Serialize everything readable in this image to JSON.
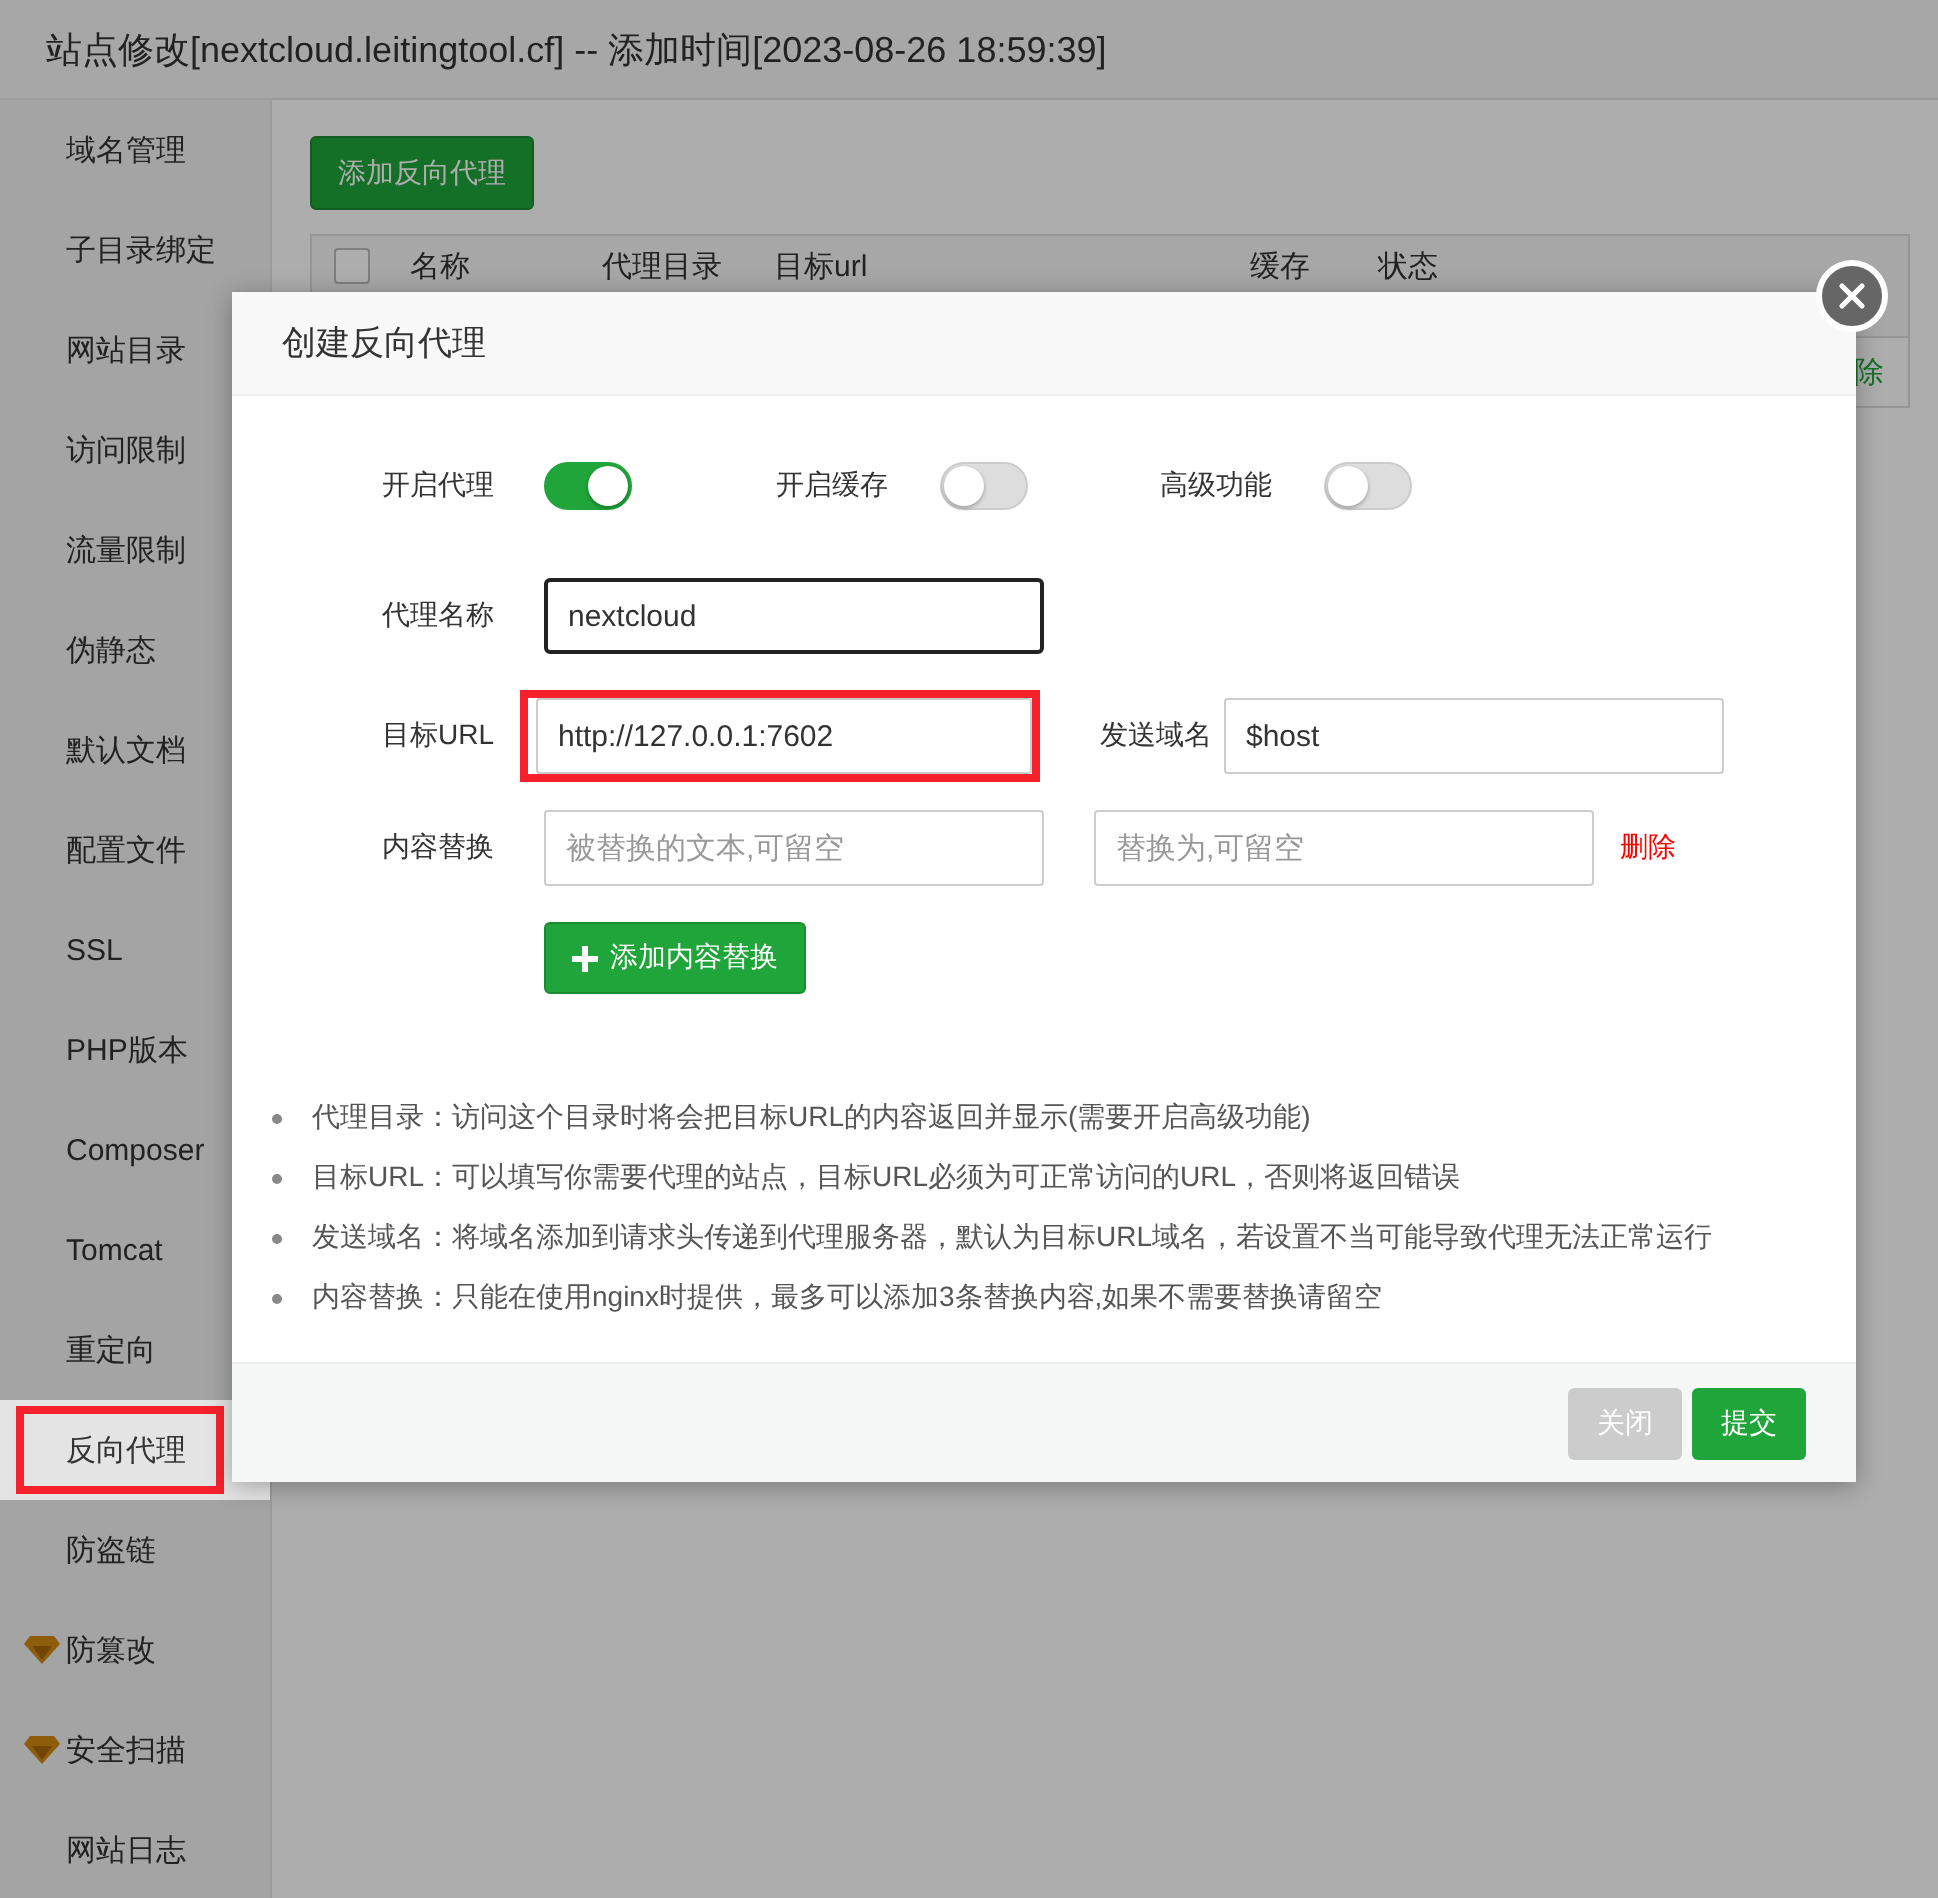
{
  "window": {
    "title": "站点修改[nextcloud.leitingtool.cf] -- 添加时间[2023-08-26 18:59:39]"
  },
  "sidebar": {
    "items": [
      {
        "label": "域名管理",
        "selected": false,
        "premium": false,
        "annotated": false
      },
      {
        "label": "子目录绑定",
        "selected": false,
        "premium": false,
        "annotated": false
      },
      {
        "label": "网站目录",
        "selected": false,
        "premium": false,
        "annotated": false
      },
      {
        "label": "访问限制",
        "selected": false,
        "premium": false,
        "annotated": false
      },
      {
        "label": "流量限制",
        "selected": false,
        "premium": false,
        "annotated": false
      },
      {
        "label": "伪静态",
        "selected": false,
        "premium": false,
        "annotated": false
      },
      {
        "label": "默认文档",
        "selected": false,
        "premium": false,
        "annotated": false
      },
      {
        "label": "配置文件",
        "selected": false,
        "premium": false,
        "annotated": false
      },
      {
        "label": "SSL",
        "selected": false,
        "premium": false,
        "annotated": false
      },
      {
        "label": "PHP版本",
        "selected": false,
        "premium": false,
        "annotated": false
      },
      {
        "label": "Composer",
        "selected": false,
        "premium": false,
        "annotated": false
      },
      {
        "label": "Tomcat",
        "selected": false,
        "premium": false,
        "annotated": false
      },
      {
        "label": "重定向",
        "selected": false,
        "premium": false,
        "annotated": false
      },
      {
        "label": "反向代理",
        "selected": true,
        "premium": false,
        "annotated": true
      },
      {
        "label": "防盗链",
        "selected": false,
        "premium": false,
        "annotated": false
      },
      {
        "label": "防篡改",
        "selected": false,
        "premium": true,
        "annotated": false
      },
      {
        "label": "安全扫描",
        "selected": false,
        "premium": true,
        "annotated": false
      },
      {
        "label": "网站日志",
        "selected": false,
        "premium": false,
        "annotated": false
      }
    ]
  },
  "toolbar": {
    "add_button": "添加反向代理"
  },
  "table": {
    "select_all": {
      "checked": false
    },
    "columns": [
      "名称",
      "代理目录",
      "目标url",
      "缓存",
      "状态"
    ],
    "row_action": "除"
  },
  "dialog": {
    "title": "创建反向代理",
    "toggles": [
      {
        "label": "开启代理",
        "on": true
      },
      {
        "label": "开启缓存",
        "on": false
      },
      {
        "label": "高级功能",
        "on": false
      }
    ],
    "proxy_name": {
      "label": "代理名称",
      "value": "nextcloud",
      "focused": true
    },
    "target_url": {
      "label": "目标URL",
      "value": "http://127.0.0.1:7602",
      "annotated": true
    },
    "send_domain": {
      "label": "发送域名",
      "value": "$host"
    },
    "replace": {
      "label": "内容替换",
      "from_placeholder": "被替换的文本,可留空",
      "to_placeholder": "替换为,可留空",
      "delete": "删除"
    },
    "add_replace_button": "添加内容替换",
    "notes": [
      "代理目录：访问这个目录时将会把目标URL的内容返回并显示(需要开启高级功能)",
      "目标URL：可以填写你需要代理的站点，目标URL必须为可正常访问的URL，否则将返回错误",
      "发送域名：将域名添加到请求头传递到代理服务器，默认为目标URL域名，若设置不当可能导致代理无法正常运行",
      "内容替换：只能在使用nginx时提供，最多可以添加3条替换内容,如果不需要替换请留空"
    ],
    "buttons": [
      {
        "label": "关闭",
        "kind": "secondary"
      },
      {
        "label": "提交",
        "kind": "primary"
      }
    ]
  }
}
